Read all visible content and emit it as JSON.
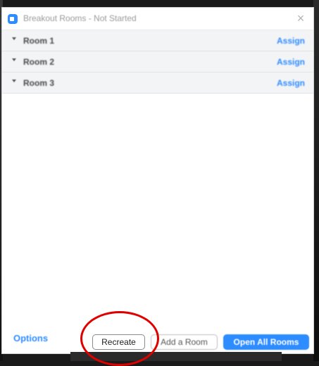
{
  "window": {
    "title": "Breakout Rooms - Not Started",
    "close_glyph": "×"
  },
  "rooms": [
    {
      "name": "Room 1",
      "action": "Assign"
    },
    {
      "name": "Room 2",
      "action": "Assign"
    },
    {
      "name": "Room 3",
      "action": "Assign"
    }
  ],
  "footer": {
    "options_label": "Options",
    "recreate_label": "Recreate",
    "add_room_label": "Add a Room",
    "open_all_label": "Open All Rooms"
  },
  "colors": {
    "accent": "#2d8cff",
    "highlight": "#e00000"
  },
  "icons": {
    "app": "zoom-app-icon",
    "close": "close-icon",
    "expand": "chevron-down-icon"
  }
}
